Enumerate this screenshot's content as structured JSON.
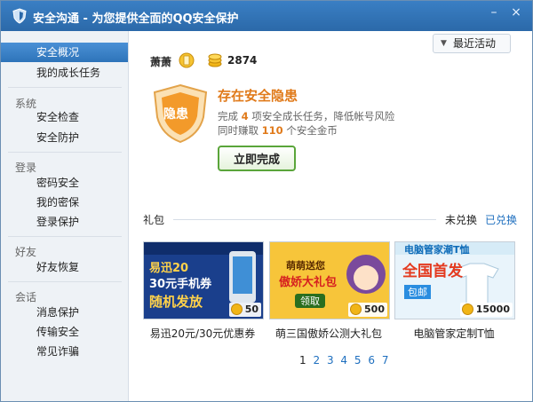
{
  "window": {
    "title": "安全沟通 - 为您提供全面的QQ安全保护",
    "min_icon": "–",
    "close_icon": "×"
  },
  "sidebar": {
    "items": [
      {
        "label": "安全概况",
        "active": true
      },
      {
        "label": "我的成长任务"
      }
    ],
    "groups": [
      {
        "title": "系统",
        "items": [
          "安全检查",
          "安全防护"
        ]
      },
      {
        "title": "登录",
        "items": [
          "密码安全",
          "我的密保",
          "登录保护"
        ]
      },
      {
        "title": "好友",
        "items": [
          "好友恢复"
        ]
      },
      {
        "title": "会话",
        "items": [
          "消息保护",
          "传输安全",
          "常见诈骗"
        ]
      }
    ]
  },
  "header": {
    "recent_label": "最近活动",
    "recent_arrow": "▼",
    "user_name": "萧萧",
    "coins": "2874"
  },
  "status": {
    "badge_text": "隐患",
    "title": "存在安全隐患",
    "line1_prefix": "完成",
    "line1_count": "4",
    "line1_suffix": "项安全成长任务，降低帐号风险",
    "line2_prefix": "同时赚取",
    "line2_amount": "110",
    "line2_suffix": "个安全金币",
    "button": "立即完成"
  },
  "gifts": {
    "label": "礼包",
    "unredeemed": "未兑换",
    "redeemed": "已兑换",
    "cards": [
      {
        "title": "易迅20元/30元优惠券",
        "price": "50",
        "art_text": [
          "易迅20",
          "30元手机券",
          "随机发放"
        ]
      },
      {
        "title": "萌三国傲娇公测大礼包",
        "price": "500",
        "art_text": [
          "萌萌送您",
          "傲娇大礼包",
          "领取"
        ]
      },
      {
        "title": "电脑管家定制T恤",
        "price": "15000",
        "art_text": [
          "电脑管家潮T恤",
          "全国首发",
          "包邮"
        ]
      }
    ],
    "pages": [
      "1",
      "2",
      "3",
      "4",
      "5",
      "6",
      "7"
    ],
    "current_page": "1"
  },
  "colors": {
    "accent": "#2e74b9",
    "warning": "#e07a1a",
    "button_border": "#5aa53a",
    "link": "#1e6fbf"
  }
}
